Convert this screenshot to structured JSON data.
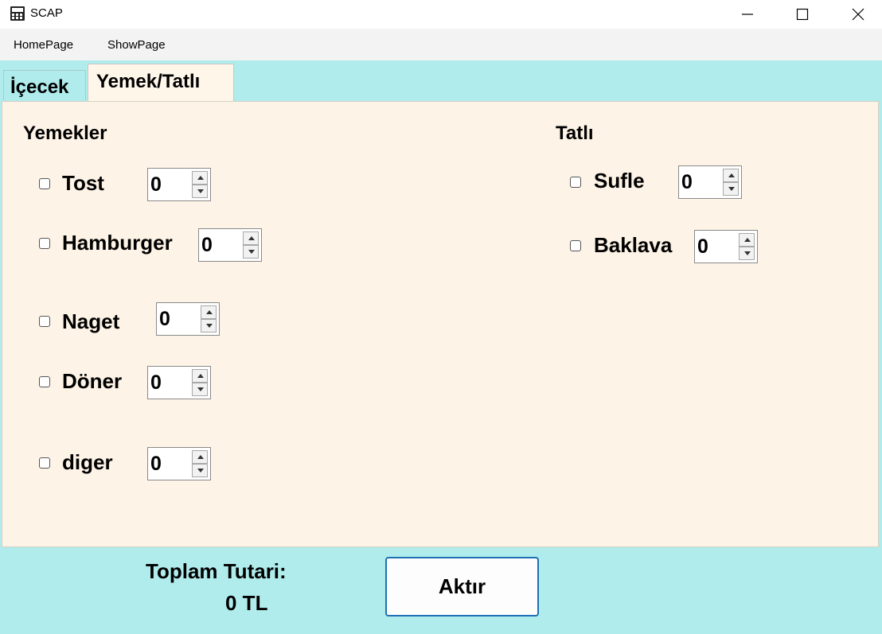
{
  "window": {
    "title": "SCAP",
    "app_icon": "calculator-icon",
    "controls": [
      "minimize-icon",
      "maximize-icon",
      "close-icon"
    ]
  },
  "menu": {
    "items": [
      "HomePage",
      "ShowPage"
    ]
  },
  "tabs": [
    {
      "label": "İçecek",
      "active": false
    },
    {
      "label": "Yemek/Tatlı",
      "active": true
    }
  ],
  "yemekler": {
    "title": "Yemekler",
    "items": [
      {
        "label": "Tost",
        "checked": false,
        "quantity": "0"
      },
      {
        "label": "Hamburger",
        "checked": false,
        "quantity": "0"
      },
      {
        "label": "Naget",
        "checked": false,
        "quantity": "0"
      },
      {
        "label": "Döner",
        "checked": false,
        "quantity": "0"
      },
      {
        "label": "diger",
        "checked": false,
        "quantity": "0"
      }
    ]
  },
  "tatli": {
    "title": "Tatlı",
    "items": [
      {
        "label": "Sufle",
        "checked": false,
        "quantity": "0"
      },
      {
        "label": "Baklava",
        "checked": false,
        "quantity": "0"
      }
    ]
  },
  "footer": {
    "total_label": "Toplam Tutari:",
    "total_value": "0 TL",
    "button_label": "Aktır"
  },
  "colors": {
    "background": "#b0ecec",
    "panel": "#fdf3e6",
    "button_border": "#1e6fb6"
  }
}
